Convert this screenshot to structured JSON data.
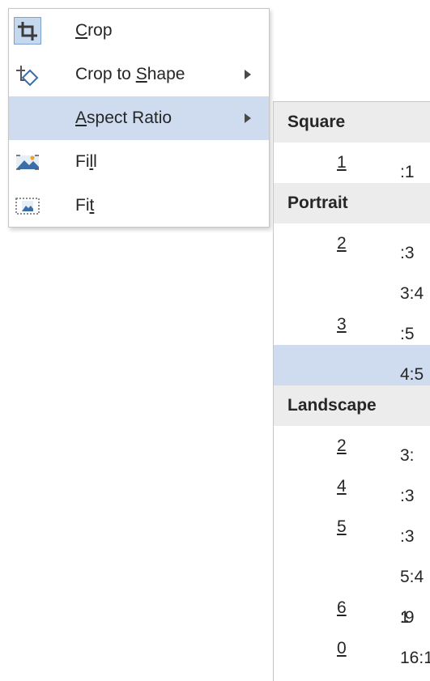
{
  "menu": {
    "items": [
      {
        "pre": "",
        "acc": "C",
        "post": "rop",
        "arrow": false,
        "icon": "crop-icon"
      },
      {
        "pre": "Crop to ",
        "acc": "S",
        "post": "hape",
        "arrow": true,
        "icon": "crop-to-shape-icon"
      },
      {
        "pre": "",
        "acc": "A",
        "post": "spect Ratio",
        "arrow": true,
        "icon": ""
      },
      {
        "pre": "Fi",
        "acc": "l",
        "post": "l",
        "arrow": false,
        "icon": "fill-picture-icon"
      },
      {
        "pre": "Fi",
        "acc": "t",
        "post": "",
        "arrow": false,
        "icon": "fit-picture-icon"
      }
    ]
  },
  "submenu": {
    "rows": [
      {
        "type": "header",
        "text": "Square"
      },
      {
        "type": "option",
        "pre": "",
        "acc": "1",
        "post": ":1"
      },
      {
        "type": "header",
        "text": "Portrait"
      },
      {
        "type": "option",
        "pre": "",
        "acc": "2",
        "post": ":3"
      },
      {
        "type": "option",
        "pre": "3:4",
        "acc": "",
        "post": ""
      },
      {
        "type": "option",
        "pre": "",
        "acc": "3",
        "post": ":5"
      },
      {
        "type": "option",
        "pre": "4:5",
        "acc": "",
        "post": ""
      },
      {
        "type": "header",
        "text": "Landscape"
      },
      {
        "type": "option",
        "pre": "3:",
        "acc": "2",
        "post": ""
      },
      {
        "type": "option",
        "pre": "",
        "acc": "4",
        "post": ":3"
      },
      {
        "type": "option",
        "pre": "",
        "acc": "5",
        "post": ":3"
      },
      {
        "type": "option",
        "pre": "5:4",
        "acc": "",
        "post": ""
      },
      {
        "type": "option",
        "pre": "1",
        "acc": "6",
        "post": ":9"
      },
      {
        "type": "option",
        "pre": "16:1",
        "acc": "0",
        "post": ""
      }
    ]
  },
  "colors": {
    "highlight": "#cfdcef",
    "header_bg": "#ececec",
    "icon_blue": "#3b6ea8"
  }
}
